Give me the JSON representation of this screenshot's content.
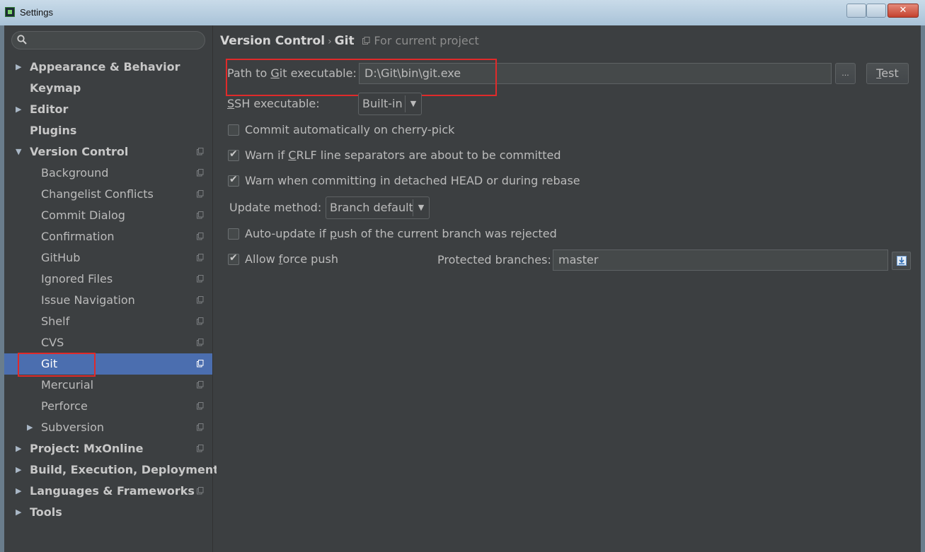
{
  "window": {
    "title": "Settings"
  },
  "sidebar": {
    "search_placeholder": "",
    "items": [
      {
        "label": "Appearance & Behavior",
        "level": 0,
        "expanded": false,
        "bold": true,
        "project_scope": false
      },
      {
        "label": "Keymap",
        "level": 0,
        "leaf": true,
        "bold": true,
        "project_scope": false
      },
      {
        "label": "Editor",
        "level": 0,
        "expanded": false,
        "bold": true,
        "project_scope": false
      },
      {
        "label": "Plugins",
        "level": 0,
        "leaf": true,
        "bold": true,
        "project_scope": false
      },
      {
        "label": "Version Control",
        "level": 0,
        "expanded": true,
        "bold": true,
        "project_scope": true
      },
      {
        "label": "Background",
        "level": 1,
        "project_scope": true
      },
      {
        "label": "Changelist Conflicts",
        "level": 1,
        "project_scope": true
      },
      {
        "label": "Commit Dialog",
        "level": 1,
        "project_scope": true
      },
      {
        "label": "Confirmation",
        "level": 1,
        "project_scope": true
      },
      {
        "label": "GitHub",
        "level": 1,
        "project_scope": true
      },
      {
        "label": "Ignored Files",
        "level": 1,
        "project_scope": true
      },
      {
        "label": "Issue Navigation",
        "level": 1,
        "project_scope": true
      },
      {
        "label": "Shelf",
        "level": 1,
        "project_scope": true
      },
      {
        "label": "CVS",
        "level": 1,
        "project_scope": true
      },
      {
        "label": "Git",
        "level": 1,
        "project_scope": true,
        "selected": true
      },
      {
        "label": "Mercurial",
        "level": 1,
        "project_scope": true
      },
      {
        "label": "Perforce",
        "level": 1,
        "project_scope": true
      },
      {
        "label": "Subversion",
        "level": 1,
        "expanded": false,
        "project_scope": true
      },
      {
        "label": "Project: MxOnline",
        "level": 0,
        "expanded": false,
        "bold": true,
        "project_scope": true
      },
      {
        "label": "Build, Execution, Deployment",
        "level": 0,
        "expanded": false,
        "bold": true,
        "project_scope": false
      },
      {
        "label": "Languages & Frameworks",
        "level": 0,
        "expanded": false,
        "bold": true,
        "project_scope": true
      },
      {
        "label": "Tools",
        "level": 0,
        "expanded": false,
        "bold": true,
        "project_scope": false
      }
    ]
  },
  "breadcrumb": {
    "parent": "Version Control",
    "current": "Git",
    "scope": "For current project"
  },
  "git": {
    "path_label_pre": "Path to ",
    "path_label_mnemonic": "G",
    "path_label_post": "it executable:",
    "path_value": "D:\\Git\\bin\\git.exe",
    "browse_label": "...",
    "test_mnemonic": "T",
    "test_rest": "est",
    "ssh_label_mnemonic": "S",
    "ssh_label_rest": "SH executable:",
    "ssh_value": "Built-in",
    "cherry_pick": {
      "label": "Commit automatically on cherry-pick",
      "checked": false
    },
    "crlf": {
      "pre": "Warn if ",
      "mnemonic": "C",
      "post": "RLF line separators are about to be committed",
      "checked": true
    },
    "detached": {
      "label": "Warn when committing in detached HEAD or during rebase",
      "checked": true
    },
    "update_method_label": "Update method:",
    "update_method_value": "Branch default",
    "auto_update": {
      "pre": "Auto-update if ",
      "mnemonic": "p",
      "post": "ush of the current branch was rejected",
      "checked": false
    },
    "force_push": {
      "pre": "Allow ",
      "mnemonic": "f",
      "post": "orce push",
      "checked": true
    },
    "protected_label": "Protected branches:",
    "protected_value": "master"
  },
  "colors": {
    "background": "#3c3f41",
    "selection": "#4b6eaf",
    "text": "#bbbbbb",
    "highlight_box": "#e02a2a"
  }
}
